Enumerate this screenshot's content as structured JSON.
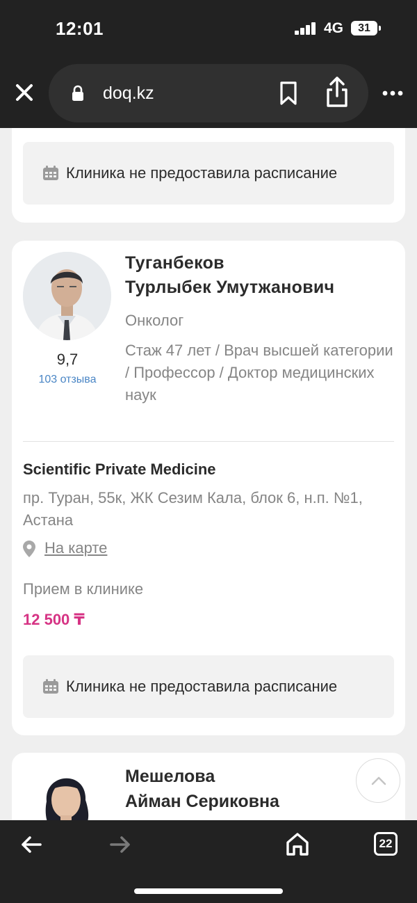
{
  "status_bar": {
    "time": "12:01",
    "network": "4G",
    "battery": "31"
  },
  "browser": {
    "url": "doq.kz",
    "tabs_count": "22"
  },
  "schedule_notice": "Клиника не предоставила расписание",
  "doctor": {
    "rating": "9,7",
    "reviews": "103 отзыва",
    "surname": "Туганбеков",
    "given_names": "Турлыбек Умутжанович",
    "specialty": "Онколог",
    "experience": "Стаж 47 лет / Врач высшей категории / Профессор / Доктор медицинских наук",
    "clinic": "Scientific Private Medicine",
    "address": "пр. Туран, 55к, ЖК Сезим Кала, блок 6, н.п. №1, Астана",
    "map_link": "На карте",
    "visit_type": "Прием в клинике",
    "price": "12 500 ₸"
  },
  "next_doctor": {
    "surname": "Мешелова",
    "given_names": "Айман Сериковна"
  },
  "colors": {
    "price": "#d63384",
    "link": "#4a86c5",
    "bars": "#222222"
  },
  "icons": [
    "close-icon",
    "lock-icon",
    "bookmark-icon",
    "share-icon",
    "more-icon",
    "calendar-icon",
    "map-pin-icon",
    "chevron-up-icon",
    "back-arrow-icon",
    "forward-arrow-icon",
    "home-icon",
    "tabs-icon"
  ]
}
